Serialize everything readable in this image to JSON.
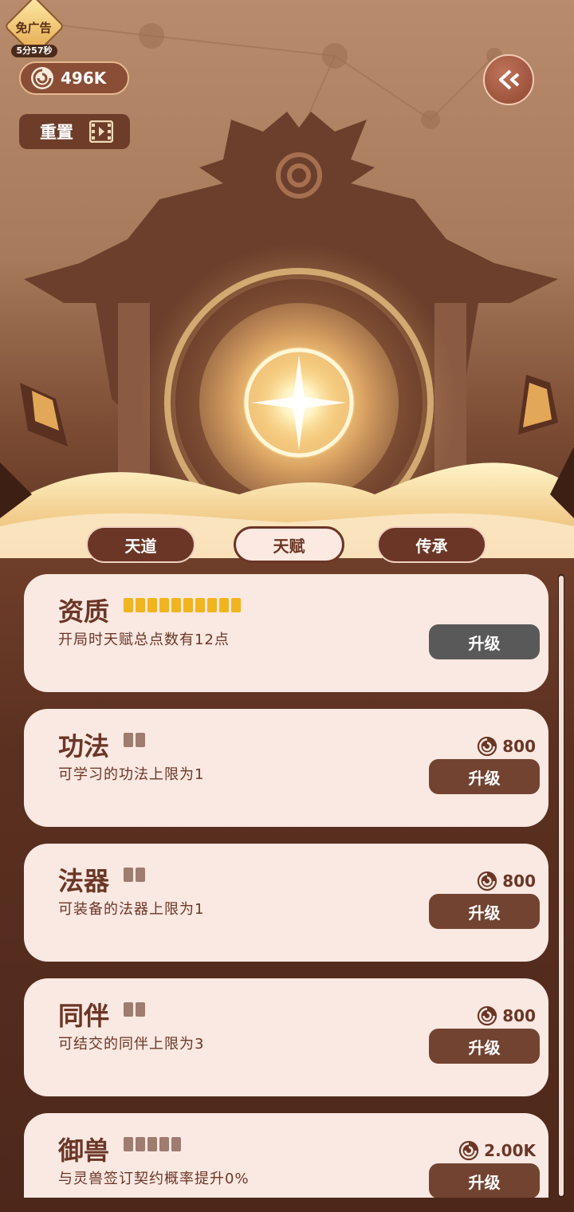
{
  "ad_badge": {
    "label": "免广告",
    "timer": "5分57秒"
  },
  "currency": {
    "amount": "496K",
    "icon": "spirit-coin-icon"
  },
  "reset": {
    "label": "重置",
    "icon": "video-ad-icon"
  },
  "back": {
    "icon": "double-chevron-left-icon"
  },
  "tabs": [
    {
      "label": "天道",
      "selected": false
    },
    {
      "label": "天赋",
      "selected": true
    },
    {
      "label": "传承",
      "selected": false
    }
  ],
  "talents": [
    {
      "name": "资质",
      "level": 10,
      "max_level": 10,
      "description": "开局时天赋总点数有12点",
      "cost": "",
      "upgrade_label": "升级",
      "upgrade_disabled": true
    },
    {
      "name": "功法",
      "level": 0,
      "max_level": 2,
      "description": "可学习的功法上限为1",
      "cost": "800",
      "upgrade_label": "升级",
      "upgrade_disabled": false
    },
    {
      "name": "法器",
      "level": 0,
      "max_level": 2,
      "description": "可装备的法器上限为1",
      "cost": "800",
      "upgrade_label": "升级",
      "upgrade_disabled": false
    },
    {
      "name": "同伴",
      "level": 0,
      "max_level": 2,
      "description": "可结交的同伴上限为3",
      "cost": "800",
      "upgrade_label": "升级",
      "upgrade_disabled": false
    },
    {
      "name": "御兽",
      "level": 0,
      "max_level": 5,
      "description": "与灵兽签订契约概率提升0%",
      "cost": "2.00K",
      "upgrade_label": "升级",
      "upgrade_disabled": false
    }
  ],
  "colors": {
    "accent_brown": "#6b3626",
    "card_bg": "#fae8e2",
    "pip_gold": "#f0b41e",
    "pip_empty": "#9e7c70",
    "button_disabled": "#595959"
  }
}
